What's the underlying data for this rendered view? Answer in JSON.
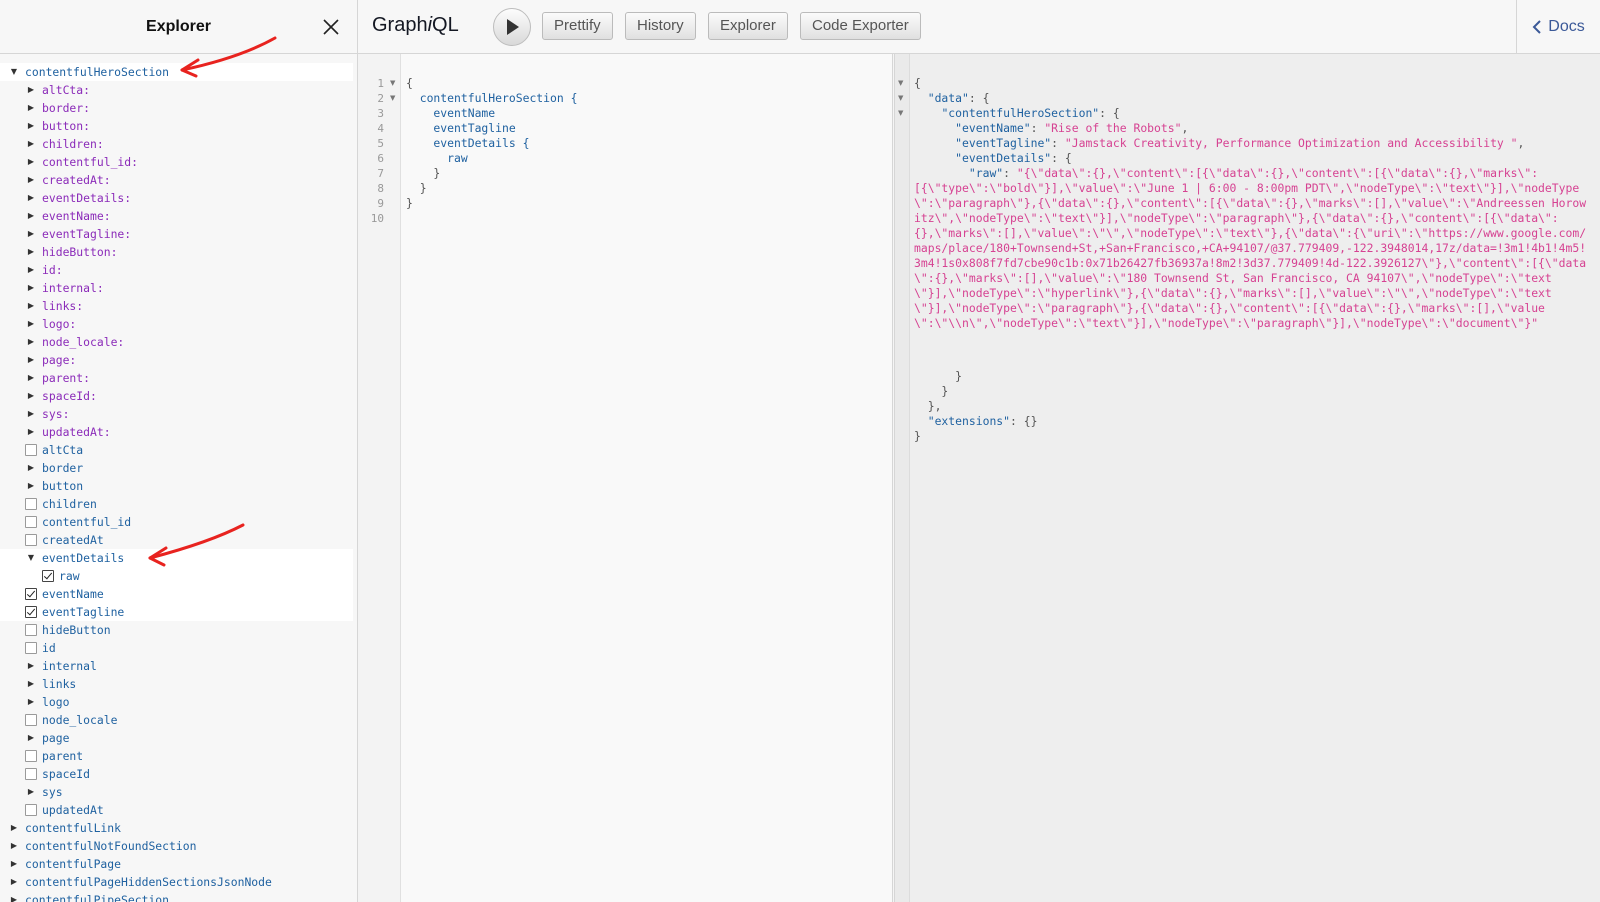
{
  "explorer": {
    "title": "Explorer",
    "rows": [
      {
        "label": "contentfulHeroSection",
        "level": 0,
        "kind": "tri-open",
        "cls": "lbl-root",
        "hl": true
      },
      {
        "label": "altCta:",
        "level": 1,
        "kind": "tri",
        "cls": "lbl-arg"
      },
      {
        "label": "border:",
        "level": 1,
        "kind": "tri",
        "cls": "lbl-arg"
      },
      {
        "label": "button:",
        "level": 1,
        "kind": "tri",
        "cls": "lbl-arg"
      },
      {
        "label": "children:",
        "level": 1,
        "kind": "tri",
        "cls": "lbl-arg"
      },
      {
        "label": "contentful_id:",
        "level": 1,
        "kind": "tri",
        "cls": "lbl-arg"
      },
      {
        "label": "createdAt:",
        "level": 1,
        "kind": "tri",
        "cls": "lbl-arg"
      },
      {
        "label": "eventDetails:",
        "level": 1,
        "kind": "tri",
        "cls": "lbl-arg"
      },
      {
        "label": "eventName:",
        "level": 1,
        "kind": "tri",
        "cls": "lbl-arg"
      },
      {
        "label": "eventTagline:",
        "level": 1,
        "kind": "tri",
        "cls": "lbl-arg"
      },
      {
        "label": "hideButton:",
        "level": 1,
        "kind": "tri",
        "cls": "lbl-arg"
      },
      {
        "label": "id:",
        "level": 1,
        "kind": "tri",
        "cls": "lbl-arg"
      },
      {
        "label": "internal:",
        "level": 1,
        "kind": "tri",
        "cls": "lbl-arg"
      },
      {
        "label": "links:",
        "level": 1,
        "kind": "tri",
        "cls": "lbl-arg"
      },
      {
        "label": "logo:",
        "level": 1,
        "kind": "tri",
        "cls": "lbl-arg"
      },
      {
        "label": "node_locale:",
        "level": 1,
        "kind": "tri",
        "cls": "lbl-arg"
      },
      {
        "label": "page:",
        "level": 1,
        "kind": "tri",
        "cls": "lbl-arg"
      },
      {
        "label": "parent:",
        "level": 1,
        "kind": "tri",
        "cls": "lbl-arg"
      },
      {
        "label": "spaceId:",
        "level": 1,
        "kind": "tri",
        "cls": "lbl-arg"
      },
      {
        "label": "sys:",
        "level": 1,
        "kind": "tri",
        "cls": "lbl-arg"
      },
      {
        "label": "updatedAt:",
        "level": 1,
        "kind": "tri",
        "cls": "lbl-arg"
      },
      {
        "label": "altCta",
        "level": 1,
        "kind": "cb",
        "cls": "lbl-field"
      },
      {
        "label": "border",
        "level": 1,
        "kind": "tri",
        "cls": "lbl-field"
      },
      {
        "label": "button",
        "level": 1,
        "kind": "tri",
        "cls": "lbl-field"
      },
      {
        "label": "children",
        "level": 1,
        "kind": "cb",
        "cls": "lbl-field"
      },
      {
        "label": "contentful_id",
        "level": 1,
        "kind": "cb",
        "cls": "lbl-field"
      },
      {
        "label": "createdAt",
        "level": 1,
        "kind": "cb",
        "cls": "lbl-field"
      },
      {
        "label": "eventDetails",
        "level": 1,
        "kind": "tri-open",
        "cls": "lbl-field",
        "hl": true
      },
      {
        "label": "raw",
        "level": 2,
        "kind": "cb-checked",
        "cls": "lbl-field",
        "hl": true
      },
      {
        "label": "eventName",
        "level": 1,
        "kind": "cb-checked",
        "cls": "lbl-field",
        "hl": true
      },
      {
        "label": "eventTagline",
        "level": 1,
        "kind": "cb-checked",
        "cls": "lbl-field",
        "hl": true
      },
      {
        "label": "hideButton",
        "level": 1,
        "kind": "cb",
        "cls": "lbl-field"
      },
      {
        "label": "id",
        "level": 1,
        "kind": "cb",
        "cls": "lbl-field"
      },
      {
        "label": "internal",
        "level": 1,
        "kind": "tri",
        "cls": "lbl-field"
      },
      {
        "label": "links",
        "level": 1,
        "kind": "tri",
        "cls": "lbl-field"
      },
      {
        "label": "logo",
        "level": 1,
        "kind": "tri",
        "cls": "lbl-field"
      },
      {
        "label": "node_locale",
        "level": 1,
        "kind": "cb",
        "cls": "lbl-field"
      },
      {
        "label": "page",
        "level": 1,
        "kind": "tri",
        "cls": "lbl-field"
      },
      {
        "label": "parent",
        "level": 1,
        "kind": "cb",
        "cls": "lbl-field"
      },
      {
        "label": "spaceId",
        "level": 1,
        "kind": "cb",
        "cls": "lbl-field"
      },
      {
        "label": "sys",
        "level": 1,
        "kind": "tri",
        "cls": "lbl-field"
      },
      {
        "label": "updatedAt",
        "level": 1,
        "kind": "cb",
        "cls": "lbl-field"
      },
      {
        "label": "contentfulLink",
        "level": 0,
        "kind": "tri",
        "cls": "lbl-root"
      },
      {
        "label": "contentfulNotFoundSection",
        "level": 0,
        "kind": "tri",
        "cls": "lbl-root"
      },
      {
        "label": "contentfulPage",
        "level": 0,
        "kind": "tri",
        "cls": "lbl-root"
      },
      {
        "label": "contentfulPageHiddenSectionsJsonNode",
        "level": 0,
        "kind": "tri",
        "cls": "lbl-root"
      },
      {
        "label": "contentfulPipeSection",
        "level": 0,
        "kind": "tri",
        "cls": "lbl-root"
      }
    ]
  },
  "toolbar": {
    "title_prefix": "Graph",
    "title_italic": "i",
    "title_suffix": "QL",
    "buttons": [
      "Prettify",
      "History",
      "Explorer",
      "Code Exporter"
    ],
    "docs_label": "Docs"
  },
  "query": {
    "line_numbers": [
      "1",
      "2",
      "3",
      "4",
      "5",
      "6",
      "7",
      "8",
      "9",
      "10"
    ],
    "lines": [
      {
        "text": "{",
        "cls": ""
      },
      {
        "text": "  contentfulHeroSection {",
        "cls": "q-def"
      },
      {
        "text": "    eventName",
        "cls": "q-def"
      },
      {
        "text": "    eventTagline",
        "cls": "q-def"
      },
      {
        "text": "    eventDetails {",
        "cls": "q-def"
      },
      {
        "text": "      raw",
        "cls": "q-def"
      },
      {
        "text": "    }",
        "cls": ""
      },
      {
        "text": "  }",
        "cls": ""
      },
      {
        "text": "}",
        "cls": ""
      },
      {
        "text": "",
        "cls": ""
      }
    ]
  },
  "result": {
    "line1": "{",
    "data_key": "\"data\"",
    "section_key": "\"contentfulHeroSection\"",
    "eventName_key": "\"eventName\"",
    "eventName_val": "\"Rise of the Robots\"",
    "eventTagline_key": "\"eventTagline\"",
    "eventTagline_val": "\"Jamstack Creativity, Performance Optimization and Accessibility \"",
    "eventDetails_key": "\"eventDetails\"",
    "raw_key": "\"raw\"",
    "raw_val": "\"{\\\"data\\\":{},\\\"content\\\":[{\\\"data\\\":{},\\\"content\\\":[{\\\"data\\\":{},\\\"marks\\\":[{\\\"type\\\":\\\"bold\\\"}],\\\"value\\\":\\\"June 1 | 6:00 - 8:00pm PDT\\\",\\\"nodeType\\\":\\\"text\\\"}],\\\"nodeType\\\":\\\"paragraph\\\"},{\\\"data\\\":{},\\\"content\\\":[{\\\"data\\\":{},\\\"marks\\\":[],\\\"value\\\":\\\"Andreessen Horowitz\\\",\\\"nodeType\\\":\\\"text\\\"}],\\\"nodeType\\\":\\\"paragraph\\\"},{\\\"data\\\":{},\\\"content\\\":[{\\\"data\\\":{},\\\"marks\\\":[],\\\"value\\\":\\\"\\\",\\\"nodeType\\\":\\\"text\\\"},{\\\"data\\\":{\\\"uri\\\":\\\"https://www.google.com/maps/place/180+Townsend+St,+San+Francisco,+CA+94107/@37.779409,-122.3948014,17z/data=!3m1!4b1!4m5!3m4!1s0x808f7fd7cbe90c1b:0x71b26427fb36937a!8m2!3d37.779409!4d-122.3926127\\\"},\\\"content\\\":[{\\\"data\\\":{},\\\"marks\\\":[],\\\"value\\\":\\\"180 Townsend St, San Francisco, CA 94107\\\",\\\"nodeType\\\":\\\"text\\\"}],\\\"nodeType\\\":\\\"hyperlink\\\"},{\\\"data\\\":{},\\\"marks\\\":[],\\\"value\\\":\\\"\\\",\\\"nodeType\\\":\\\"text\\\"}],\\\"nodeType\\\":\\\"paragraph\\\"},{\\\"data\\\":{},\\\"content\\\":[{\\\"data\\\":{},\\\"marks\\\":[],\\\"value\\\":\\\"\\\\n\\\",\\\"nodeType\\\":\\\"text\\\"}],\\\"nodeType\\\":\\\"paragraph\\\"}],\\\"nodeType\\\":\\\"document\\\"}\"",
    "extensions_key": "\"extensions\"",
    "extensions_val": "{}"
  },
  "colors": {
    "annotation_arrow": "#e8231f",
    "type_name": "#1f61a0",
    "argument": "#8b2bb9",
    "string": "#d64292"
  }
}
